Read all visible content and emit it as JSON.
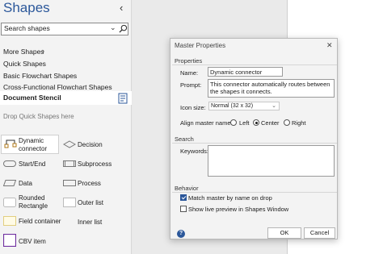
{
  "shapes_pane": {
    "title": "Shapes",
    "search_placeholder": "Search shapes",
    "more_shapes": "More Shapes",
    "stencils": [
      "Quick Shapes",
      "Basic Flowchart Shapes",
      "Cross-Functional Flowchart Shapes"
    ],
    "current_stencil": "Document Stencil",
    "drop_hint": "Drop Quick Shapes here",
    "shapes": [
      {
        "label": "Dynamic connector"
      },
      {
        "label": "Decision"
      },
      {
        "label": "Start/End"
      },
      {
        "label": "Subprocess"
      },
      {
        "label": "Data"
      },
      {
        "label": "Process"
      },
      {
        "label": "Rounded Rectangle"
      },
      {
        "label": "Outer list"
      },
      {
        "label": "Field container"
      },
      {
        "label": "Inner list"
      },
      {
        "label": "CBV item"
      }
    ]
  },
  "dialog": {
    "title": "Master Properties",
    "properties_section": "Properties",
    "name_label": "Name:",
    "name_value": "Dynamic connector",
    "prompt_label": "Prompt:",
    "prompt_value": "This connector automatically routes between the shapes it connects.",
    "icon_size_label": "Icon size:",
    "icon_size_value": "Normal (32 x 32)",
    "align_label": "Align master name:",
    "align_options": [
      "Left",
      "Center",
      "Right"
    ],
    "align_selected": "Center",
    "search_section": "Search",
    "keywords_label": "Keywords:",
    "keywords_value": "",
    "behavior_section": "Behavior",
    "match_by_name_label": "Match master by name on drop",
    "match_by_name_checked": true,
    "live_preview_label": "Show live preview in Shapes Window",
    "live_preview_checked": false,
    "ok_label": "OK",
    "cancel_label": "Cancel",
    "help_label": "?"
  },
  "colors": {
    "accent": "#2b579a"
  }
}
